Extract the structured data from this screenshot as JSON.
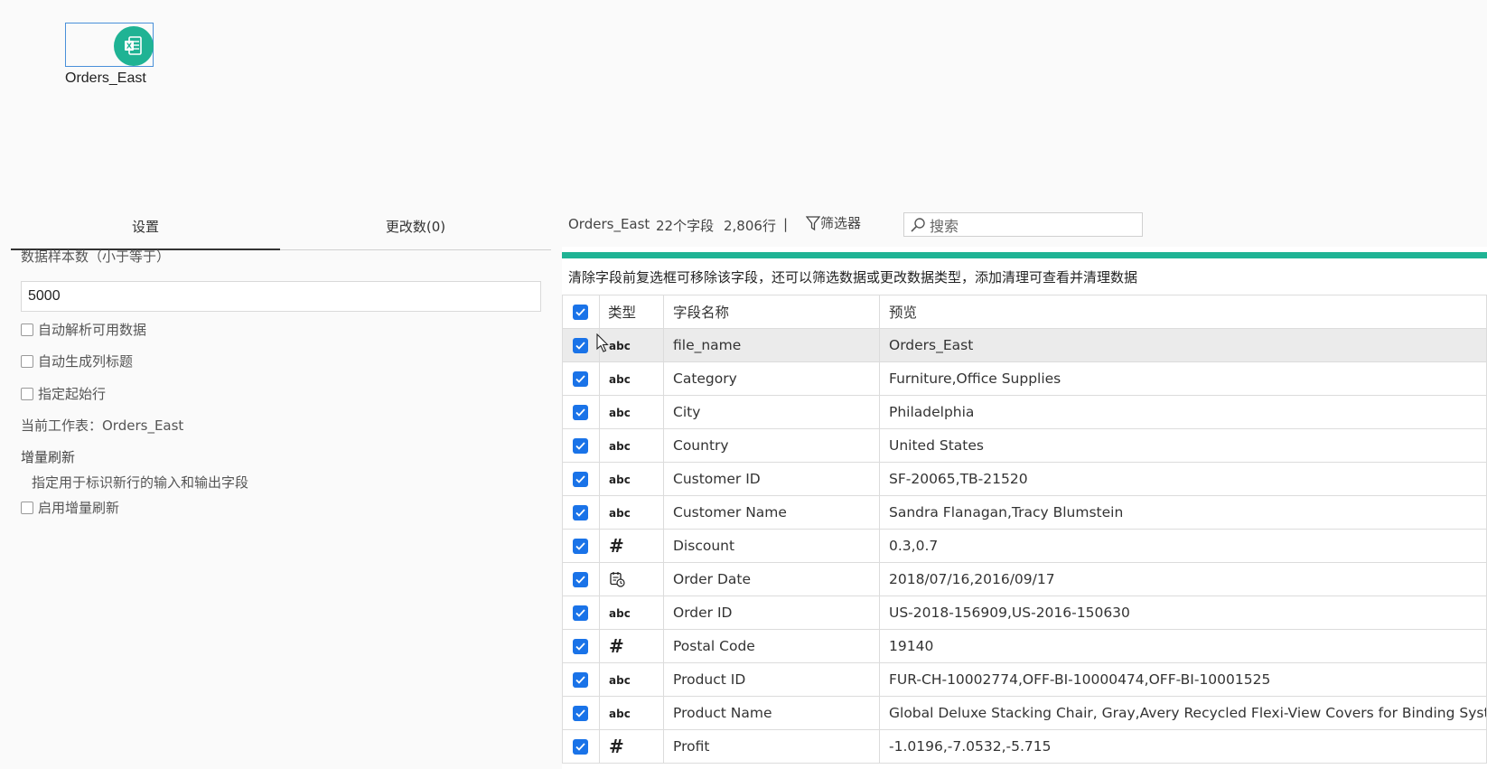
{
  "canvas": {
    "node_label": "Orders_East",
    "node_icon": "excel-file-icon"
  },
  "settings": {
    "tabs": [
      "设置",
      "更改数(0)"
    ],
    "sample_label": "数据样本数（小于等于）",
    "sample_value": "5000",
    "options": [
      "自动解析可用数据",
      "自动生成列标题",
      "指定起始行"
    ],
    "current_sheet": "当前工作表：Orders_East",
    "incremental_title": "增量刷新",
    "incremental_desc": "指定用于标识新行的输入和输出字段",
    "incremental_option": "启用增量刷新"
  },
  "toolbar": {
    "name": "Orders_East",
    "field_count": "22个字段",
    "row_count": "2,806行",
    "separator": "|",
    "filter_label": "筛选器",
    "search_placeholder": "搜索"
  },
  "hint": "清除字段前复选框可移除该字段，还可以筛选数据或更改数据类型，添加清理可查看并清理数据",
  "table": {
    "headers": {
      "type": "类型",
      "name": "字段名称",
      "preview": "预览"
    },
    "rows": [
      {
        "type": "abc",
        "name": "file_name",
        "preview": "Orders_East"
      },
      {
        "type": "abc",
        "name": "Category",
        "preview": "Furniture,Office Supplies"
      },
      {
        "type": "abc",
        "name": "City",
        "preview": "Philadelphia"
      },
      {
        "type": "abc",
        "name": "Country",
        "preview": "United States"
      },
      {
        "type": "abc",
        "name": "Customer ID",
        "preview": "SF-20065,TB-21520"
      },
      {
        "type": "abc",
        "name": "Customer Name",
        "preview": "Sandra Flanagan,Tracy Blumstein"
      },
      {
        "type": "#",
        "name": "Discount",
        "preview": "0.3,0.7"
      },
      {
        "type": "date",
        "name": "Order Date",
        "preview": "2018/07/16,2016/09/17"
      },
      {
        "type": "abc",
        "name": "Order ID",
        "preview": "US-2018-156909,US-2016-150630"
      },
      {
        "type": "#",
        "name": "Postal Code",
        "preview": "19140"
      },
      {
        "type": "abc",
        "name": "Product ID",
        "preview": "FUR-CH-10002774,OFF-BI-10000474,OFF-BI-10001525"
      },
      {
        "type": "abc",
        "name": "Product Name",
        "preview": "Global Deluxe Stacking Chair, Gray,Avery Recycled Flexi-View Covers for Binding Systems,..."
      },
      {
        "type": "#",
        "name": "Profit",
        "preview": "-1.0196,-7.0532,-5.715"
      }
    ]
  },
  "colors": {
    "accent": "#1fb394",
    "checkbox": "#1a73e8",
    "node_border": "#4a90d9"
  }
}
